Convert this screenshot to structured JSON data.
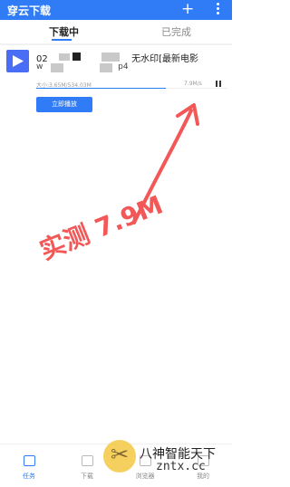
{
  "appbar": {
    "title": "穿云下载",
    "add_icon": "plus-icon",
    "more_icon": "more-vert-icon"
  },
  "tabs": [
    {
      "label": "下载中",
      "active": true
    },
    {
      "label": "已完成",
      "active": false
    }
  ],
  "download": {
    "title_prefix": "02",
    "title_suffix": "无水印[最新电影",
    "subtitle_prefix": "w",
    "subtitle_suffix": "p4",
    "size": "大小:3.65M/534.03M",
    "speed": "7.9M/s",
    "progress": 0.68,
    "play_label": "立即播放"
  },
  "annotation": {
    "text": "实测 7.9M",
    "color": "#f25858"
  },
  "bottom_nav": [
    {
      "label": "任务",
      "active": true
    },
    {
      "label": "下载",
      "active": false
    },
    {
      "label": "浏览器",
      "active": false
    },
    {
      "label": "我的",
      "active": false
    }
  ],
  "watermark": {
    "line1": "八神智能天下",
    "line2": "zntx.cc"
  },
  "colors": {
    "primary": "#2f7cf6",
    "annotation": "#f25858"
  }
}
